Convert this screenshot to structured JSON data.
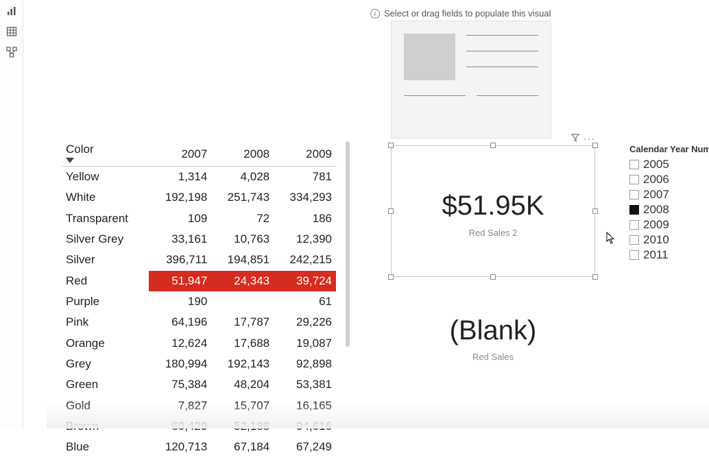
{
  "hint_text": "Select or drag fields to populate this visual",
  "matrix": {
    "col_header_label": "Color",
    "columns": [
      "2007",
      "2008",
      "2009"
    ],
    "rows": [
      {
        "label": "Yellow",
        "vals": [
          "1,314",
          "4,028",
          "781"
        ],
        "hl": false
      },
      {
        "label": "White",
        "vals": [
          "192,198",
          "251,743",
          "334,293"
        ],
        "hl": false
      },
      {
        "label": "Transparent",
        "vals": [
          "109",
          "72",
          "186"
        ],
        "hl": false
      },
      {
        "label": "Silver Grey",
        "vals": [
          "33,161",
          "10,763",
          "12,390"
        ],
        "hl": false
      },
      {
        "label": "Silver",
        "vals": [
          "396,711",
          "194,851",
          "242,215"
        ],
        "hl": false
      },
      {
        "label": "Red",
        "vals": [
          "51,947",
          "24,343",
          "39,724"
        ],
        "hl": true
      },
      {
        "label": "Purple",
        "vals": [
          "190",
          "",
          "61"
        ],
        "hl": false
      },
      {
        "label": "Pink",
        "vals": [
          "64,196",
          "17,787",
          "29,226"
        ],
        "hl": false
      },
      {
        "label": "Orange",
        "vals": [
          "12,624",
          "17,688",
          "19,087"
        ],
        "hl": false
      },
      {
        "label": "Grey",
        "vals": [
          "180,994",
          "192,143",
          "92,898"
        ],
        "hl": false
      },
      {
        "label": "Green",
        "vals": [
          "75,384",
          "48,204",
          "53,381"
        ],
        "hl": false
      },
      {
        "label": "Gold",
        "vals": [
          "7,827",
          "15,707",
          "16,165"
        ],
        "hl": false
      },
      {
        "label": "Brown",
        "vals": [
          "60,429",
          "52,188",
          "94,616"
        ],
        "hl": false
      },
      {
        "label": "Blue",
        "vals": [
          "120,713",
          "67,184",
          "67,249"
        ],
        "hl": false
      }
    ]
  },
  "card1": {
    "value": "$51.95K",
    "label": "Red Sales 2"
  },
  "card2": {
    "value": "(Blank)",
    "label": "Red Sales"
  },
  "slicer": {
    "title": "Calendar Year Number",
    "items": [
      {
        "label": "2005",
        "checked": false
      },
      {
        "label": "2006",
        "checked": false
      },
      {
        "label": "2007",
        "checked": false
      },
      {
        "label": "2008",
        "checked": true
      },
      {
        "label": "2009",
        "checked": false
      },
      {
        "label": "2010",
        "checked": false
      },
      {
        "label": "2011",
        "checked": false
      }
    ]
  }
}
